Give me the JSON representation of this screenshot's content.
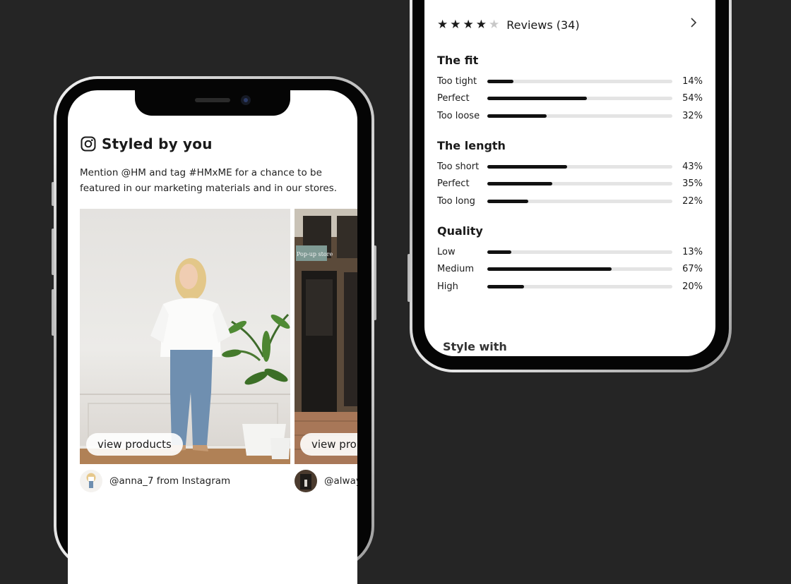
{
  "left_phone": {
    "section_title": "Styled by you",
    "description": "Mention @HM and tag #HMxME for a chance to be featured in our marketing materials and in our stores.",
    "posts": [
      {
        "button_label": "view products",
        "username": "@anna_7 from Instagram"
      },
      {
        "button_label": "view pro",
        "username": "@alway",
        "storefront_sign": "Pop-up store"
      }
    ]
  },
  "right_phone": {
    "rating": {
      "stars_filled": 4,
      "stars_total": 5,
      "label": "Reviews (34)"
    },
    "sections": [
      {
        "title": "The fit",
        "rows": [
          {
            "label": "Too tight",
            "value": "14%",
            "fraction": 0.14
          },
          {
            "label": "Perfect",
            "value": "54%",
            "fraction": 0.54
          },
          {
            "label": "Too loose",
            "value": "32%",
            "fraction": 0.32
          }
        ]
      },
      {
        "title": "The length",
        "rows": [
          {
            "label": "Too short",
            "value": "43%",
            "fraction": 0.43
          },
          {
            "label": "Perfect",
            "value": "35%",
            "fraction": 0.35
          },
          {
            "label": "Too long",
            "value": "22%",
            "fraction": 0.22
          }
        ]
      },
      {
        "title": "Quality",
        "rows": [
          {
            "label": "Low",
            "value": "13%",
            "fraction": 0.13
          },
          {
            "label": "Medium",
            "value": "67%",
            "fraction": 0.67
          },
          {
            "label": "High",
            "value": "20%",
            "fraction": 0.2
          }
        ]
      }
    ],
    "style_with_title": "Style with"
  },
  "colors": {
    "background": "#252525",
    "bar_fill": "#111111",
    "bar_track": "#e4e4e4",
    "star_filled": "#1a1a1a",
    "star_empty": "#c8c8c8"
  }
}
